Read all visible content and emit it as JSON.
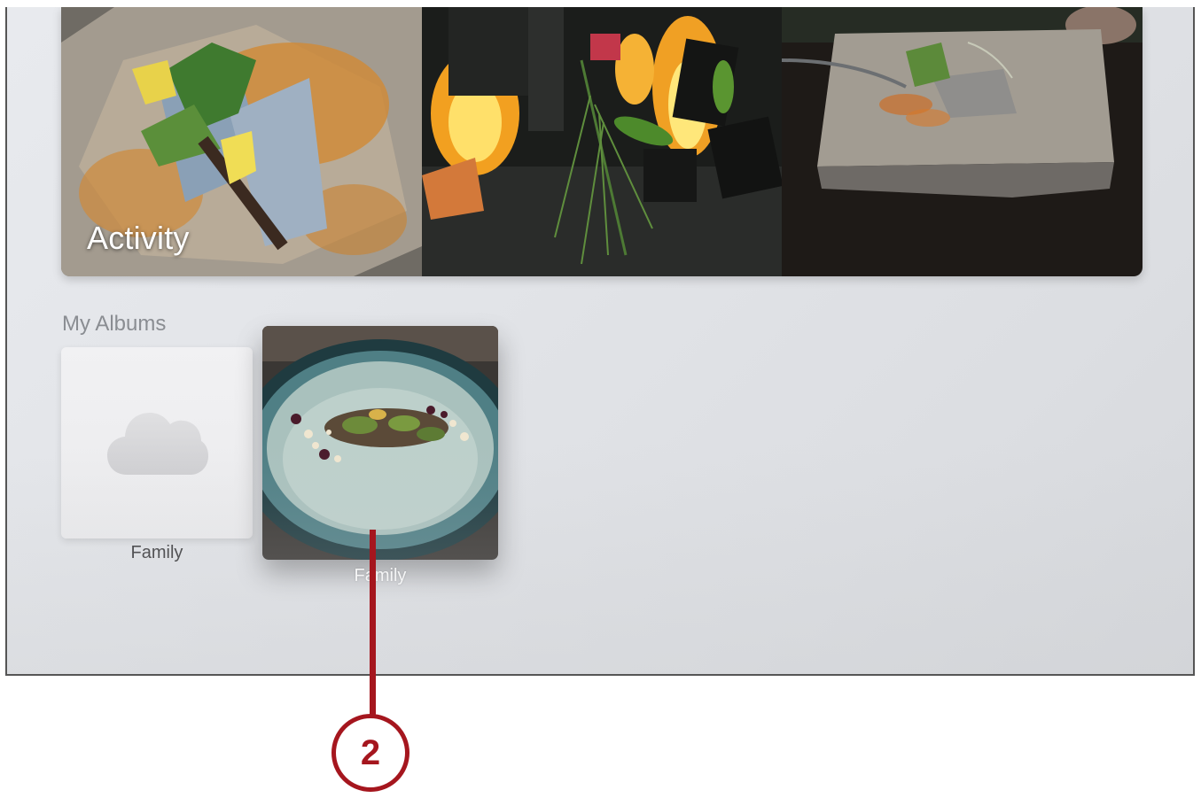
{
  "activity": {
    "title": "Activity"
  },
  "my_albums": {
    "section_title": "My Albums",
    "albums": [
      {
        "label": "Family",
        "thumbnail": "cloud-icon"
      },
      {
        "label": "Family",
        "thumbnail": "food-plate-photo",
        "focused": true
      }
    ]
  },
  "callout": {
    "number": "2",
    "color": "#a5161e"
  }
}
